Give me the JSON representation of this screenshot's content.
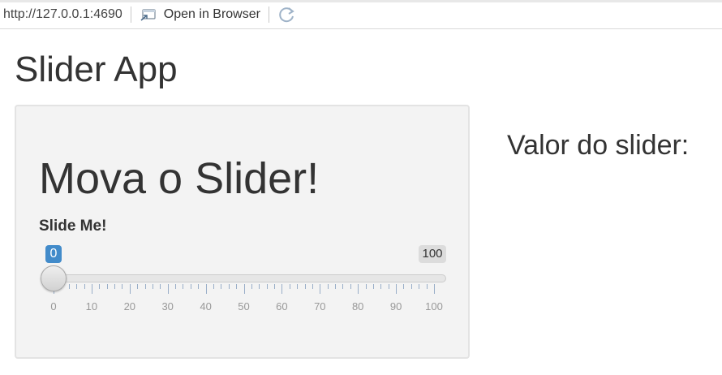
{
  "browser": {
    "url": "http://127.0.0.1:4690",
    "open_label": "Open in Browser"
  },
  "page": {
    "title": "Slider App"
  },
  "panel": {
    "heading": "Mova o Slider!",
    "slider": {
      "label": "Slide Me!",
      "min": 0,
      "max": 100,
      "value": 0,
      "min_badge": "0",
      "max_badge": "100",
      "major_ticks": [
        "0",
        "10",
        "20",
        "30",
        "40",
        "50",
        "60",
        "70",
        "80",
        "90",
        "100"
      ],
      "accent_color": "#428bca"
    }
  },
  "output": {
    "label": "Valor do slider:"
  }
}
